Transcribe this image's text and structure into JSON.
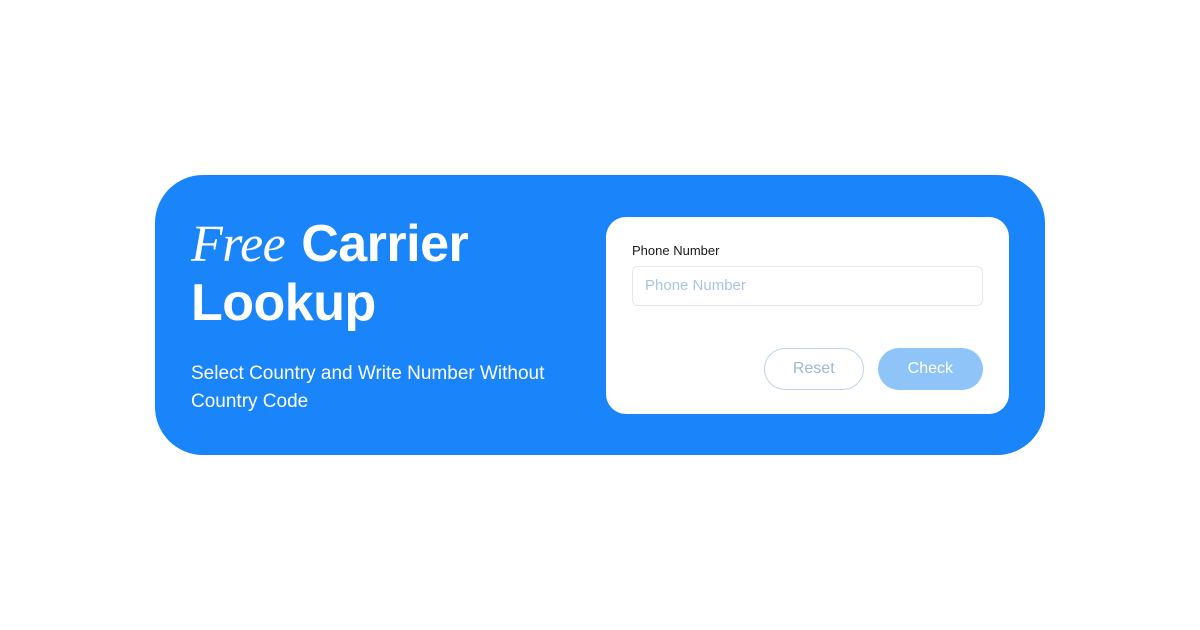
{
  "heading": {
    "prefix": "Free",
    "rest": "Carrier Lookup"
  },
  "subtitle": "Select Country and Write Number Without Country Code",
  "form": {
    "phone_label": "Phone Number",
    "phone_placeholder": "Phone Number",
    "phone_value": "",
    "reset_label": "Reset",
    "check_label": "Check"
  },
  "colors": {
    "brand_blue": "#1a85fb",
    "check_button": "#8ec4f7"
  }
}
